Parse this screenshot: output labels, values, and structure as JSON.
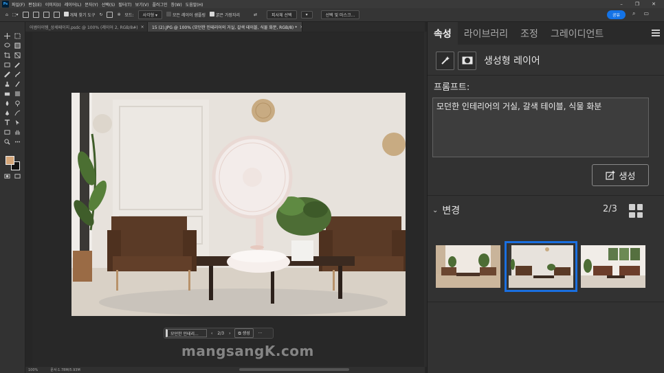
{
  "menubar": {
    "app_logo": "Ps",
    "items": [
      "파일(F)",
      "편집(E)",
      "이미지(I)",
      "레이어(L)",
      "문자(Y)",
      "선택(S)",
      "필터(T)",
      "보기(V)",
      "플러그인",
      "창(W)",
      "도움말(H)"
    ]
  },
  "options_bar": {
    "auto_select_label": "개체 찾기 도구",
    "mode_label": "모드:",
    "mode_value": "사각형",
    "sample_all_layers": "모든 레이어 샘플링",
    "hard_edge": "굵은 가장자리",
    "subject_button": "피사체 선택",
    "select_mask_button": "선택 및 마스크...",
    "share_button": "공유"
  },
  "document_tabs": [
    {
      "label": "어썸아이템_상세페이지.psdc @ 100% (레이어 2, RGB/8#)",
      "active": false
    },
    {
      "label": "15 (2).JPG @ 100% (모던한 인테리어의 거실, 갈색 테이블, 식물 화분, RGB/8) *",
      "active": true
    }
  ],
  "context_bar": {
    "prompt": "모던한 인테리...",
    "page": "2/3",
    "generate": "생성",
    "more": "···"
  },
  "watermark": "mangsangK.com",
  "status_bar": {
    "zoom": "100%",
    "doc_size": "문서:1.78M/5.93M"
  },
  "panel": {
    "tabs": [
      {
        "label": "속성",
        "active": true
      },
      {
        "label": "라이브러리",
        "active": false
      },
      {
        "label": "조정",
        "active": false
      },
      {
        "label": "그레이디언트",
        "active": false
      }
    ],
    "layer_type": "생성형 레이어",
    "prompt_label": "프롬프트:",
    "prompt_text": "모던한 인테리어의 거실, 갈색 테이블, 식물 화분",
    "generate_button": "생성",
    "variations_title": "변경",
    "variations_count": "2/3",
    "selected_variation": 2
  },
  "colors": {
    "accent": "#1473e6",
    "selection_outline": "#1a6fe0",
    "foreground_swatch": "#d5a679",
    "background_swatch": "#111111"
  }
}
